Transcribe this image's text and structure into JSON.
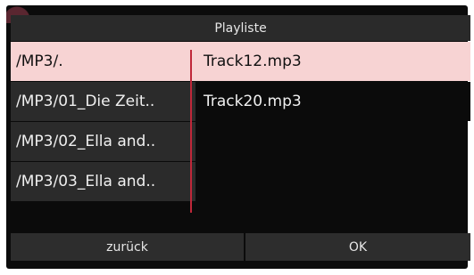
{
  "dialog": {
    "title": "Playliste"
  },
  "directories": [
    {
      "label": "/MP3/.",
      "selected": true
    },
    {
      "label": "/MP3/01_Die Zeit..",
      "selected": false
    },
    {
      "label": "/MP3/02_Ella and..",
      "selected": false
    },
    {
      "label": "/MP3/03_Ella and..",
      "selected": false
    }
  ],
  "files": [
    {
      "label": "Track12.mp3",
      "selected": true
    },
    {
      "label": "Track20.mp3",
      "selected": false
    }
  ],
  "buttons": {
    "back_label": "zurück",
    "ok_label": "OK"
  },
  "colors": {
    "selection": "#f7d3d3",
    "scroll_indicator": "#c0283a",
    "panel_background": "#0b0b0b"
  }
}
